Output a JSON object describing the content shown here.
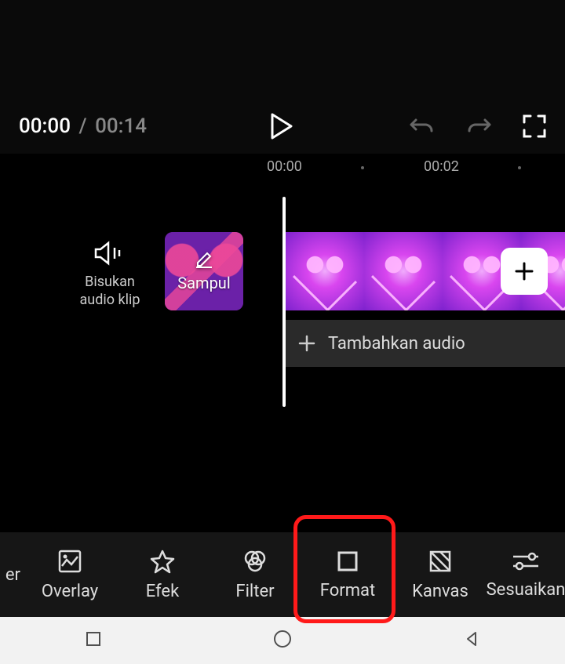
{
  "playback": {
    "current": "00:00",
    "separator": "/",
    "total": "00:14"
  },
  "ruler": {
    "ticks": [
      "00:00",
      "00:02"
    ]
  },
  "timeline": {
    "mute_label_line1": "Bisukan",
    "mute_label_line2": "audio klip",
    "cover_label": "Sampul",
    "add_audio_label": "Tambahkan audio"
  },
  "toolbar": {
    "items": [
      {
        "label": "er"
      },
      {
        "label": "Overlay"
      },
      {
        "label": "Efek"
      },
      {
        "label": "Filter"
      },
      {
        "label": "Format"
      },
      {
        "label": "Kanvas"
      },
      {
        "label": "Sesuaikan"
      }
    ]
  }
}
